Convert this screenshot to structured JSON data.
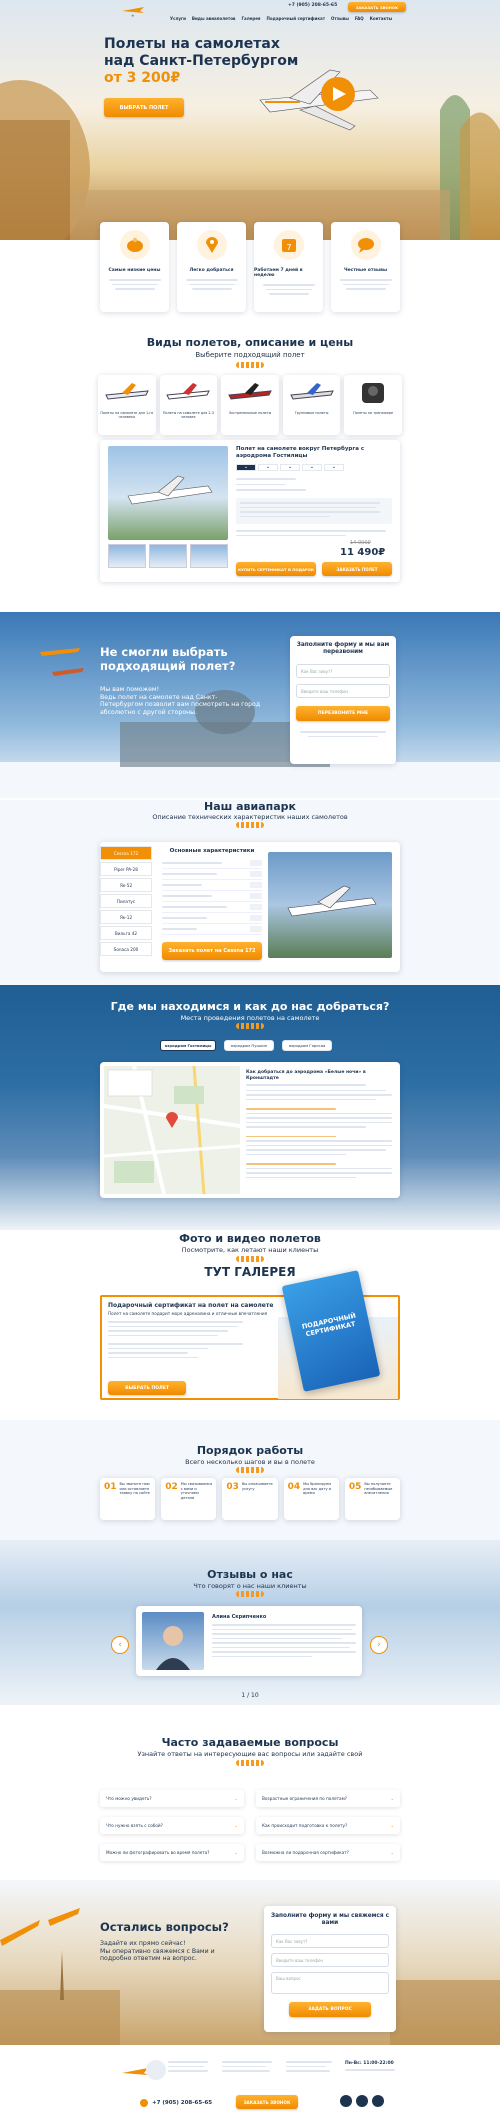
{
  "nav": {
    "phone": "+7 (905) 208-65-65",
    "menu": [
      "Услуги",
      "Виды авиаполетов",
      "Галерея",
      "Подарочный сертификат",
      "Отзывы",
      "FAQ",
      "Контакты"
    ],
    "cta": "ЗАКАЗАТЬ ЗВОНОК"
  },
  "hero": {
    "title_l1": "Полеты на самолетах",
    "title_l2": "над Санкт-Петербургом",
    "price": "от 3 200₽",
    "button": "ВЫБРАТЬ ПОЛЕТ"
  },
  "features": [
    {
      "label": "Самые низкие цены",
      "icon": "piggy-bank-icon"
    },
    {
      "label": "Легко добраться",
      "icon": "map-pin-icon"
    },
    {
      "label": "Работаем 7 дней в неделю",
      "icon": "calendar-icon"
    },
    {
      "label": "Честные отзывы",
      "icon": "chat-icon"
    }
  ],
  "types": {
    "title": "Виды полетов, описание и цены",
    "subtitle": "Выберите подходящий полет",
    "thumbs": [
      "Полеты на самолете для 1-го человека",
      "Полеты на самолете для 2-3 человек",
      "Экстремальные полеты",
      "Групповые полеты",
      "Полеты на тренажере"
    ],
    "product_title": "Полет на самолете вокруг Петербурга с аэродрома Гостилицы",
    "old_price": "14 000₽",
    "price": "11 490₽",
    "buy_cert": "КУПИТЬ СЕРТИФИКАТ В ПОДАРОК",
    "order": "ЗАКАЗАТЬ ПОЛЕТ"
  },
  "callback1": {
    "title_l1": "Не смогли выбрать",
    "title_l2": "подходящий полет?",
    "text_l1": "Мы вам поможем!",
    "text_l2": "Ведь полет на самолете над Санкт-",
    "text_l3": "Петербургом позволит вам посмотреть на город",
    "text_l4": "абсолютно с другой стороны.",
    "form_title": "Заполните форму и мы вам перезвоним",
    "name_ph": "Как Вас зовут?",
    "phone_ph": "Введите ваш телефон",
    "button": "ПЕРЕЗВОНИТЕ МНЕ"
  },
  "fleet": {
    "title": "Наш авиапарк",
    "subtitle": "Описание технических характеристик наших самолетов",
    "tabs": [
      "Cessna 172",
      "Piper PA-28",
      "Як-52",
      "Пилатус",
      "Як-12",
      "Вильга 42",
      "Sonaca 200"
    ],
    "spec_title": "Основные характеристики",
    "button": "Заказать полет на Cessna 172"
  },
  "location": {
    "title": "Где мы находимся и как до нас добраться?",
    "subtitle": "Места проведения полетов на самолете",
    "tabs": [
      "аэродром Гостилицы",
      "аэродром Пушкин",
      "аэродром Горская"
    ],
    "route_title": "Как добраться до аэродрома «Белые ночи» в Кронштадте"
  },
  "gallery": {
    "title": "Фото и видео полетов",
    "subtitle": "Посмотрите, как летают наши клиенты",
    "banner": "ТУТ ГАЛЕРЕЯ"
  },
  "certificate": {
    "title": "Подарочный сертификат на полет на самолете",
    "subtitle": "Полет на самолете подарит море адреналина и отличные впечатления",
    "button": "ВЫБРАТЬ ПОЛЕТ",
    "card_text": "ПОДАРОЧНЫЙ СЕРТИФИКАТ"
  },
  "steps": {
    "title": "Порядок работы",
    "subtitle": "Всего несколько шагов и вы в полете",
    "items": [
      {
        "num": "01",
        "text": "Вы звоните нам или оставляете заявку на сайте"
      },
      {
        "num": "02",
        "text": "Мы связываемся с вами и уточняем детали"
      },
      {
        "num": "03",
        "text": "Вы оплачиваете услугу"
      },
      {
        "num": "04",
        "text": "Мы бронируем для вас дату и время"
      },
      {
        "num": "05",
        "text": "Вы получаете незабываемые впечатления"
      }
    ]
  },
  "reviews": {
    "title": "Отзывы о нас",
    "subtitle": "Что говорят о нас наши клиенты",
    "name": "Алина Скрипченко",
    "pager": "1 / 10"
  },
  "faq": {
    "title": "Часто задаваемые вопросы",
    "subtitle": "Узнайте ответы на интересующие вас вопросы или задайте свой",
    "items": [
      "Что можно увидеть?",
      "Возрастные ограничения по полетам?",
      "Что нужно взять с собой?",
      "Как происходит подготовка к полету?",
      "Можно ли фотографировать во время полета?",
      "Возможна ли подарочная сертификат?"
    ]
  },
  "contact": {
    "title_l1": "Остались вопросы?",
    "text_l1": "Задайте их прямо сейчас!",
    "text_l2": "Мы оперативно свяжемся с Вами и",
    "text_l3": "подробно ответим на вопрос.",
    "form_title": "Заполните форму и мы свяжемся с вами",
    "name_ph": "Как Вас зовут?",
    "phone_ph": "Введите ваш телефон",
    "question_ph": "Ваш вопрос",
    "button": "ЗАДАТЬ ВОПРОС"
  },
  "footer": {
    "phone": "+7 (905) 208-65-65",
    "phone2": "Пн-Вс: 11:00-22:00",
    "cta": "ЗАКАЗАТЬ ЗВОНОК"
  },
  "colors": {
    "accent": "#f18f06",
    "navy": "#1d3450",
    "sky": "#3a78b6"
  }
}
